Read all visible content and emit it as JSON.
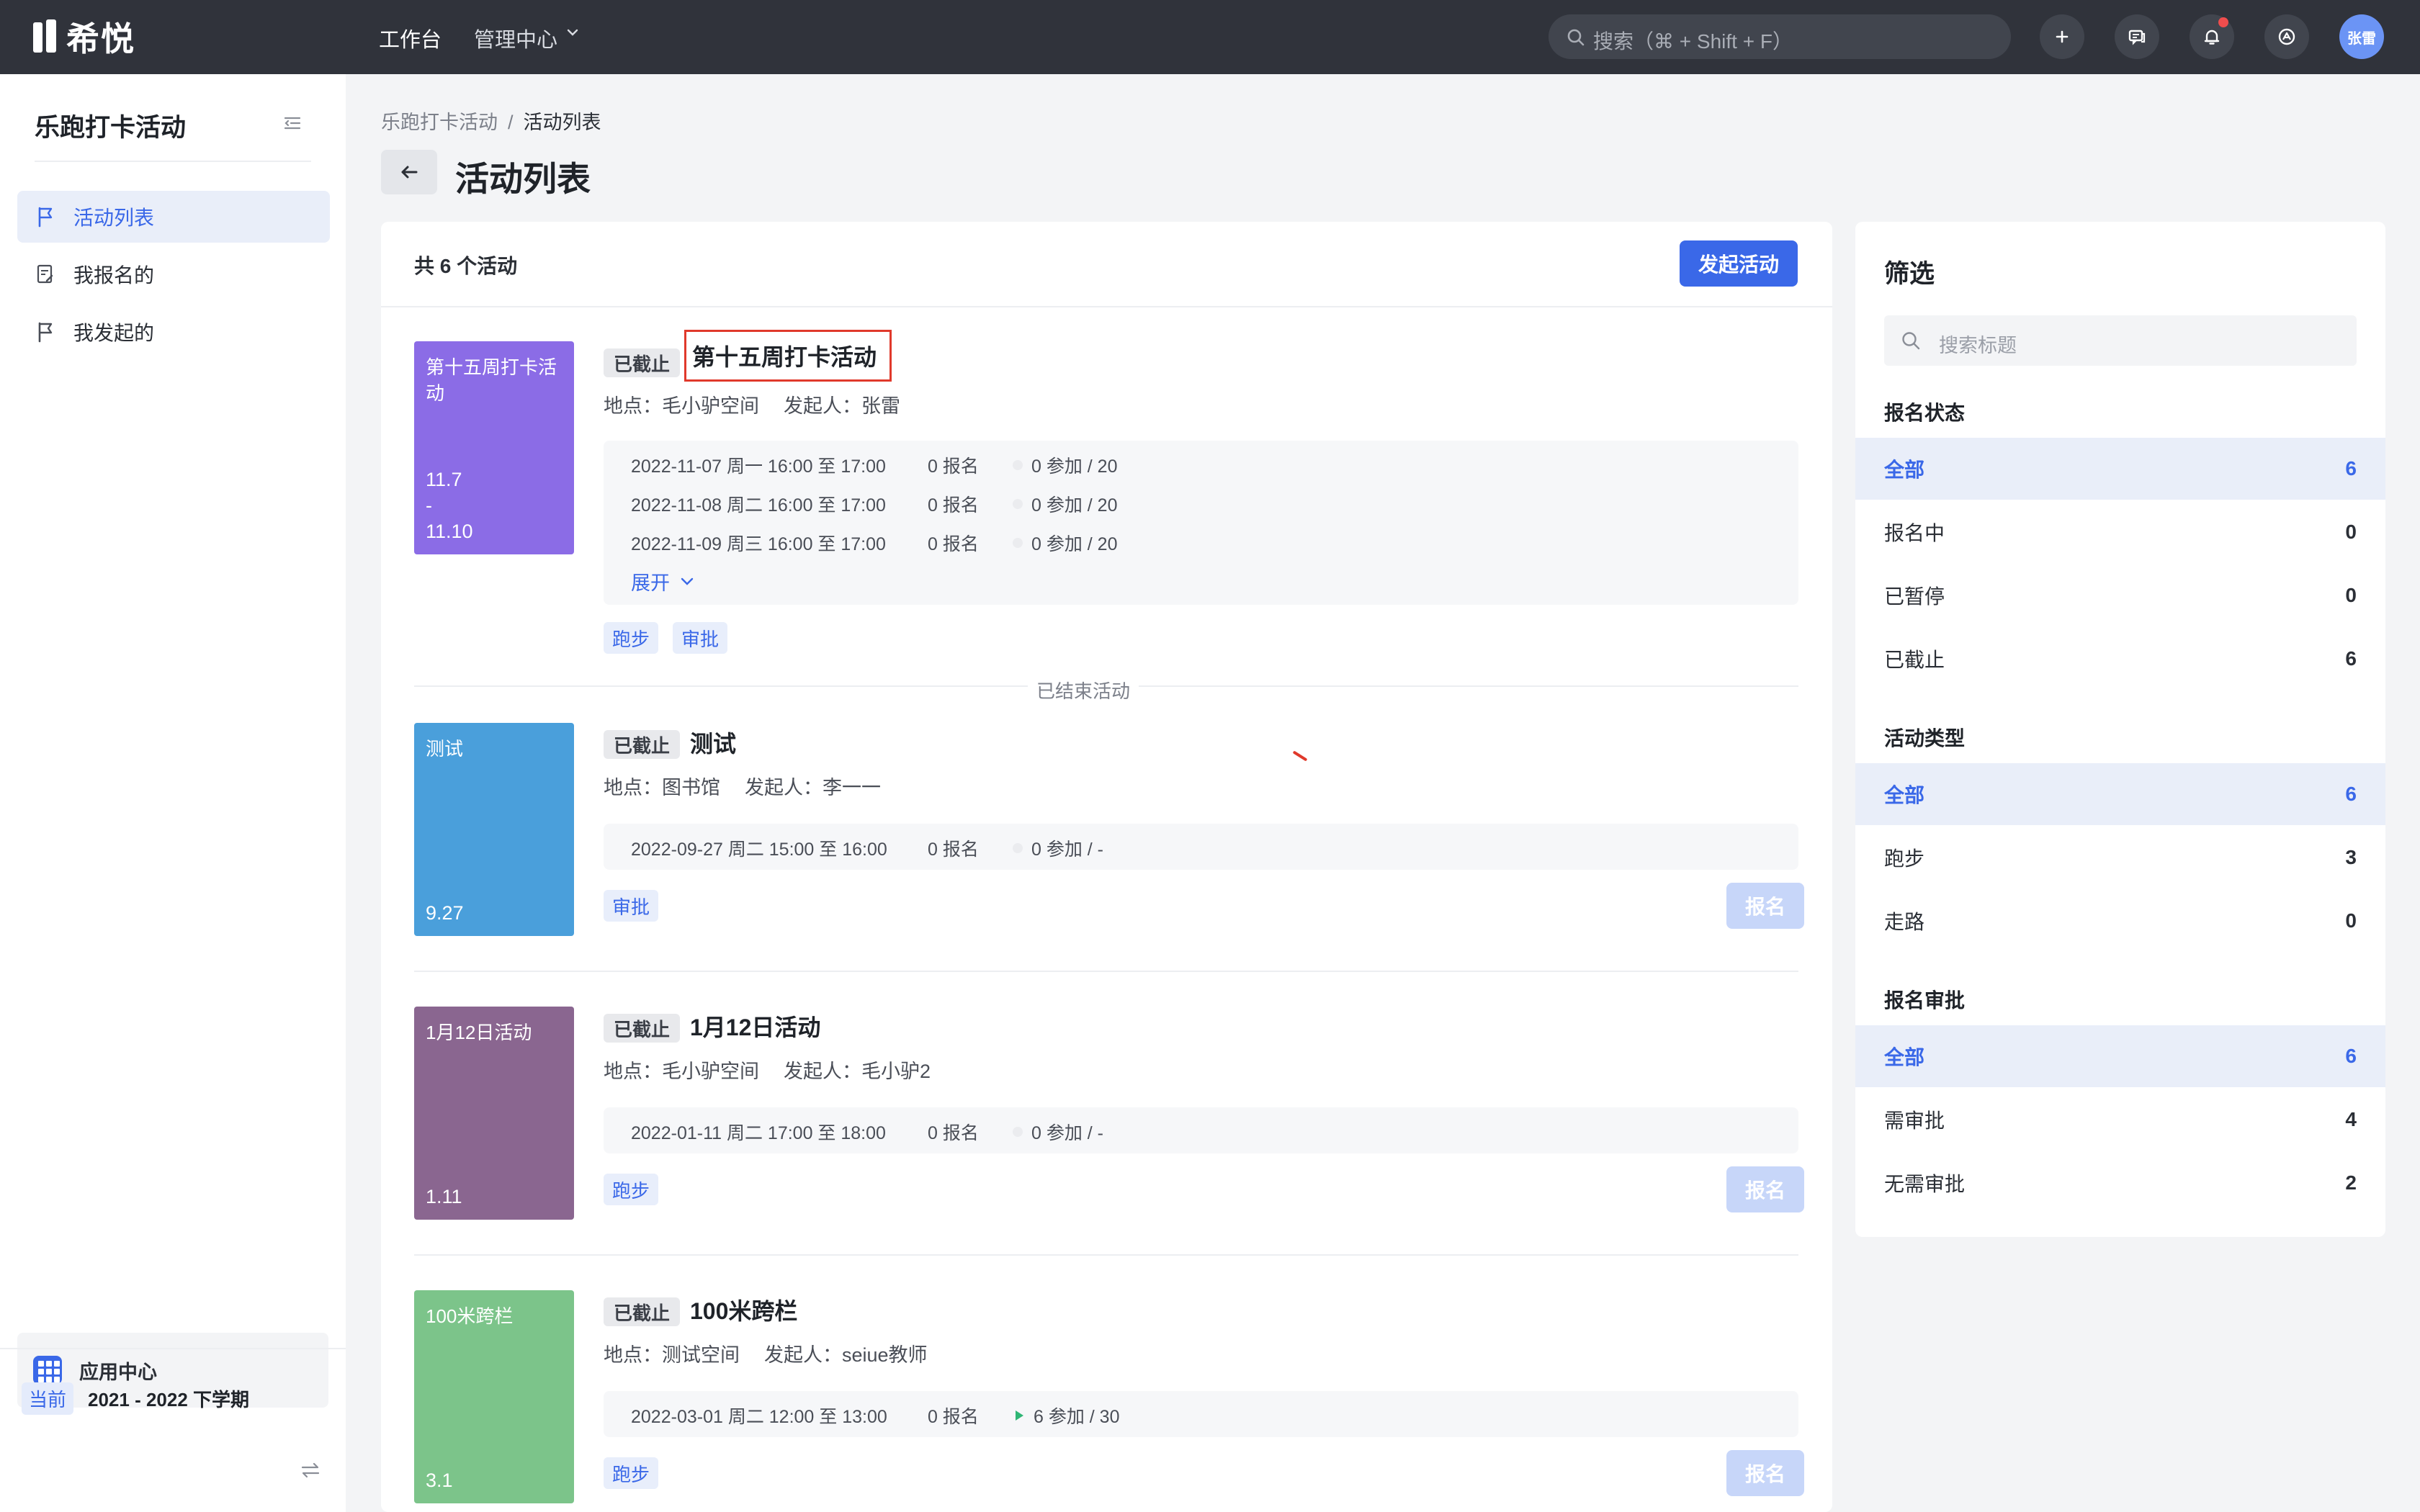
{
  "topbar": {
    "logo": "希悦",
    "nav": [
      "工作台",
      "管理中心"
    ],
    "search_placeholder": "搜索（⌘ + Shift + F）",
    "user": "张雷"
  },
  "sidebar": {
    "title": "乐跑打卡活动",
    "items": [
      {
        "label": "活动列表",
        "icon": "flag-icon",
        "active": true
      },
      {
        "label": "我报名的",
        "icon": "signup-doc-icon",
        "active": false
      },
      {
        "label": "我发起的",
        "icon": "flag-icon",
        "active": false
      }
    ],
    "app_center": "应用中心",
    "term_badge": "当前",
    "term": "2021 - 2022 下学期"
  },
  "breadcrumb": [
    "乐跑打卡活动",
    "活动列表"
  ],
  "page_title": "活动列表",
  "main": {
    "count_label": "共 6 个活动",
    "create_button": "发起活动",
    "ended_label": "已结束活动",
    "signup_label": "报名",
    "expand_label": "展开",
    "activities": [
      {
        "cover_title": "第十五周打卡活动",
        "cover_range": [
          "11.7",
          "-",
          "11.10"
        ],
        "cover_color": "#8b6ce6",
        "status": "已截止",
        "title": "第十五周打卡活动",
        "location": "地点：毛小驴空间",
        "organizer": "发起人：张雷",
        "sessions": [
          {
            "date": "2022-11-07 周一 16:00 至 17:00",
            "signups": "0 报名",
            "attend": "0 参加 / 20"
          },
          {
            "date": "2022-11-08 周二 16:00 至 17:00",
            "signups": "0 报名",
            "attend": "0 参加 / 20"
          },
          {
            "date": "2022-11-09 周三 16:00 至 17:00",
            "signups": "0 报名",
            "attend": "0 参加 / 20"
          }
        ],
        "tags": [
          "跑步",
          "审批"
        ]
      },
      {
        "cover_title": "测试",
        "cover_range": [
          "9.27"
        ],
        "cover_color": "#4a9fdb",
        "status": "已截止",
        "title": "测试",
        "location": "地点：图书馆",
        "organizer": "发起人：李一一",
        "sessions": [
          {
            "date": "2022-09-27 周二 15:00 至 16:00",
            "signups": "0 报名",
            "attend": "0 参加 / -"
          }
        ],
        "tags": [
          "审批"
        ]
      },
      {
        "cover_title": "1月12日活动",
        "cover_range": [
          "1.11"
        ],
        "cover_color": "#8a6690",
        "status": "已截止",
        "title": "1月12日活动",
        "location": "地点：毛小驴空间",
        "organizer": "发起人：毛小驴2",
        "sessions": [
          {
            "date": "2022-01-11 周二 17:00 至 18:00",
            "signups": "0 报名",
            "attend": "0 参加 / -"
          }
        ],
        "tags": [
          "跑步"
        ]
      },
      {
        "cover_title": "100米跨栏",
        "cover_range": [
          "3.1"
        ],
        "cover_color": "#7cc48a",
        "status": "已截止",
        "title": "100米跨栏",
        "location": "地点：测试空间",
        "organizer": "发起人：seiue教师",
        "sessions": [
          {
            "date": "2022-03-01 周二 12:00 至 13:00",
            "signups": "0 报名",
            "attend": "6 参加 / 30"
          }
        ],
        "tags": [
          "跑步"
        ]
      }
    ]
  },
  "filter": {
    "title": "筛选",
    "search_placeholder": "搜索标题",
    "groups": [
      {
        "title": "报名状态",
        "options": [
          {
            "label": "全部",
            "count": "6"
          },
          {
            "label": "报名中",
            "count": "0"
          },
          {
            "label": "已暂停",
            "count": "0"
          },
          {
            "label": "已截止",
            "count": "6"
          }
        ]
      },
      {
        "title": "活动类型",
        "options": [
          {
            "label": "全部",
            "count": "6"
          },
          {
            "label": "跑步",
            "count": "3"
          },
          {
            "label": "走路",
            "count": "0"
          }
        ]
      },
      {
        "title": "报名审批",
        "options": [
          {
            "label": "全部",
            "count": "6"
          },
          {
            "label": "需审批",
            "count": "4"
          },
          {
            "label": "无需审批",
            "count": "2"
          }
        ]
      }
    ]
  },
  "colors": {
    "accent": "#3a68e8",
    "topbar": "#30333b",
    "highlight_box": "#e0392b"
  }
}
